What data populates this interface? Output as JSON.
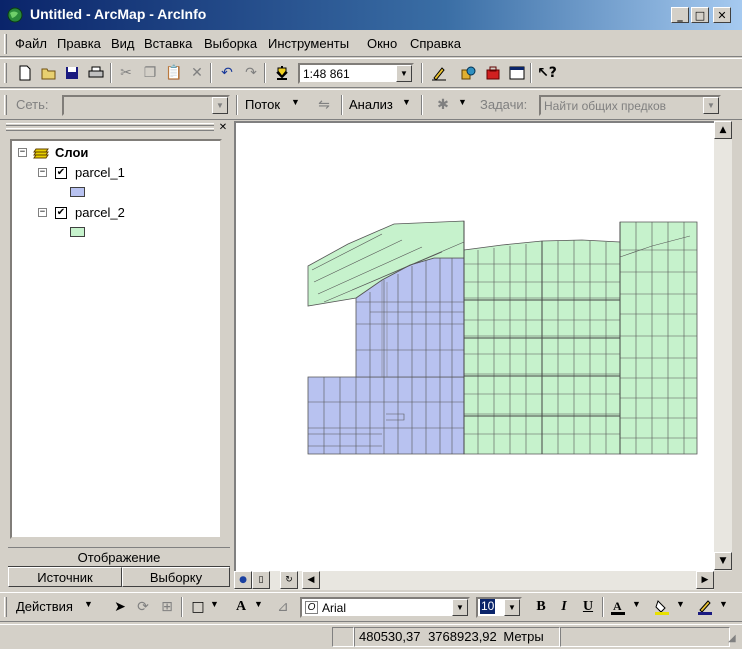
{
  "window": {
    "title": "Untitled - ArcMap - ArcInfo"
  },
  "menu": [
    "Файл",
    "Правка",
    "Вид",
    "Вставка",
    "Выборка",
    "Инструменты",
    "Окно",
    "Справка"
  ],
  "standard_toolbar": {
    "scale": "1:48 861"
  },
  "network_toolbar": {
    "network_label": "Сеть:",
    "network_value": "",
    "flow_label": "Поток",
    "analysis_label": "Анализ",
    "tasks_label": "Задачи:",
    "tasks_value": "Найти общих предков"
  },
  "toc": {
    "root_label": "Слои",
    "layers": [
      {
        "name": "parcel_1",
        "visible": true,
        "color": "#b8c2f0"
      },
      {
        "name": "parcel_2",
        "visible": true,
        "color": "#c6f2cc"
      }
    ],
    "tabs": {
      "display": "Отображение",
      "source": "Источник",
      "selection": "Выборку"
    }
  },
  "draw_toolbar": {
    "actions_label": "Действия",
    "font_name": "Arial",
    "font_size": "10",
    "bold": "B",
    "italic": "I",
    "underline": "U",
    "text_tool": "A"
  },
  "status": {
    "x": "480530,37",
    "y": "3768923,92",
    "units": "Метры"
  },
  "colors": {
    "parcel_1": "#b8c2f0",
    "parcel_2": "#c6f2cc",
    "outline": "#555555",
    "titlebar": "#0a246a"
  }
}
